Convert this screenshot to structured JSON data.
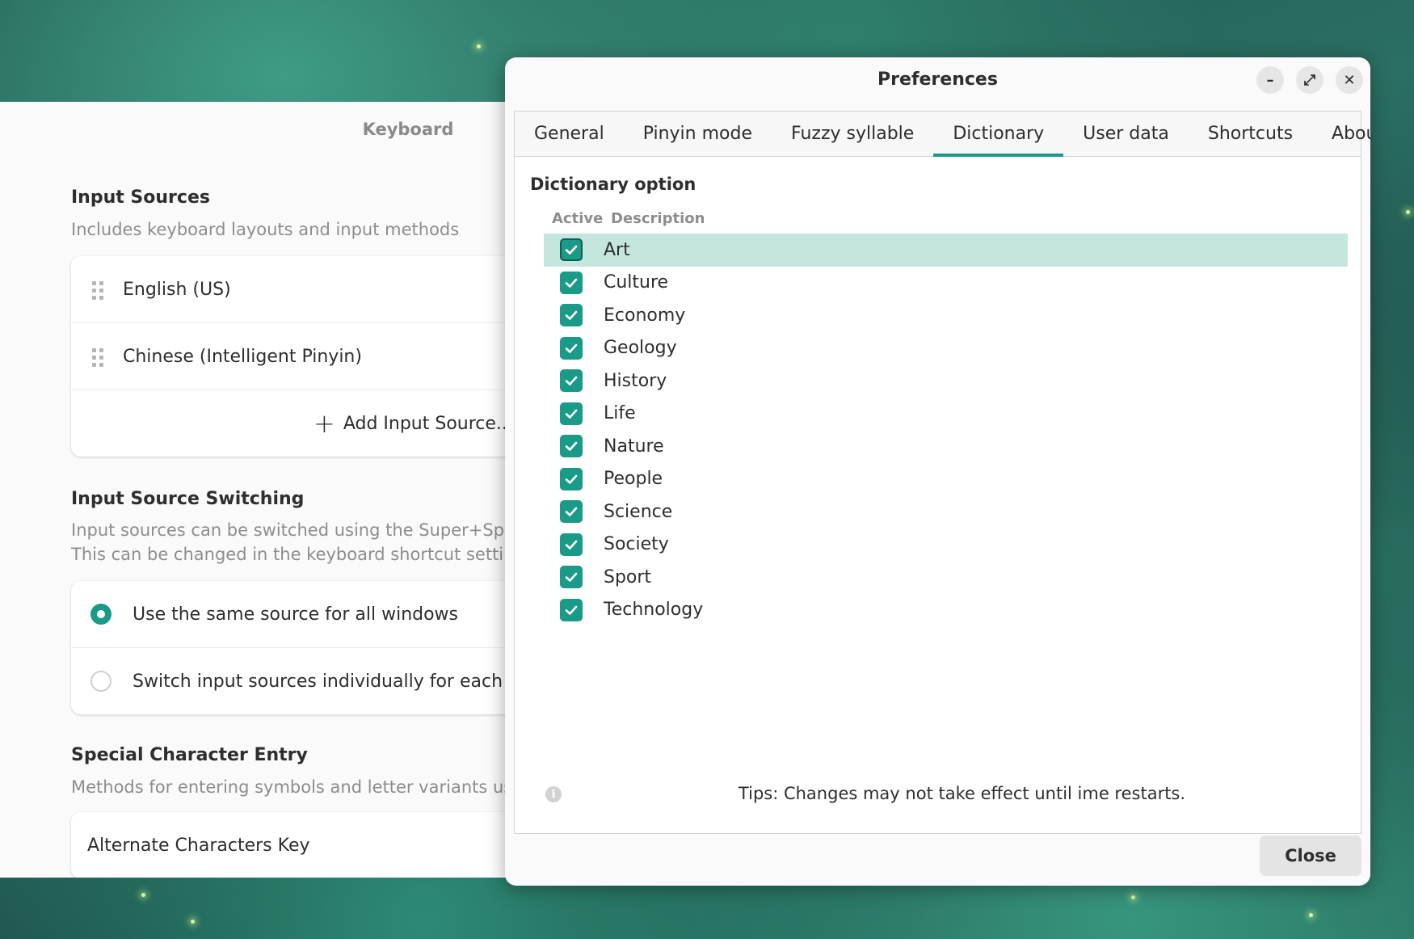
{
  "keyboard_window": {
    "title": "Keyboard",
    "input_sources": {
      "title": "Input Sources",
      "description": "Includes keyboard layouts and input methods",
      "items": [
        "English (US)",
        "Chinese (Intelligent Pinyin)"
      ],
      "add_label": "Add Input Source..."
    },
    "switching": {
      "title": "Input Source Switching",
      "description_line1": "Input sources can be switched using the Super+Spac",
      "description_line2": "This can be changed in the keyboard shortcut setting",
      "options": [
        {
          "label": "Use the same source for all windows",
          "selected": true
        },
        {
          "label": "Switch input sources individually for each win",
          "selected": false
        }
      ]
    },
    "special": {
      "title": "Special Character Entry",
      "description": "Methods for entering symbols and letter variants us",
      "row_label": "Alternate Characters Key"
    }
  },
  "preferences": {
    "title": "Preferences",
    "window_controls": {
      "minimize": "–",
      "maximize": "⤢",
      "close": "✕"
    },
    "tabs": [
      "General",
      "Pinyin mode",
      "Fuzzy syllable",
      "Dictionary",
      "User data",
      "Shortcuts",
      "About"
    ],
    "active_tab": "Dictionary",
    "dictionary": {
      "heading": "Dictionary option",
      "col_active": "Active",
      "col_description": "Description",
      "items": [
        {
          "label": "Art",
          "active": true,
          "selected": true
        },
        {
          "label": "Culture",
          "active": true
        },
        {
          "label": "Economy",
          "active": true
        },
        {
          "label": "Geology",
          "active": true
        },
        {
          "label": "History",
          "active": true
        },
        {
          "label": "Life",
          "active": true
        },
        {
          "label": "Nature",
          "active": true
        },
        {
          "label": "People",
          "active": true
        },
        {
          "label": "Science",
          "active": true
        },
        {
          "label": "Society",
          "active": true
        },
        {
          "label": "Sport",
          "active": true
        },
        {
          "label": "Technology",
          "active": true
        }
      ]
    },
    "tips": "Tips: Changes may not take effect until ime restarts.",
    "close_label": "Close"
  },
  "colors": {
    "accent": "#1a9a88",
    "selection": "#c4e6df"
  }
}
